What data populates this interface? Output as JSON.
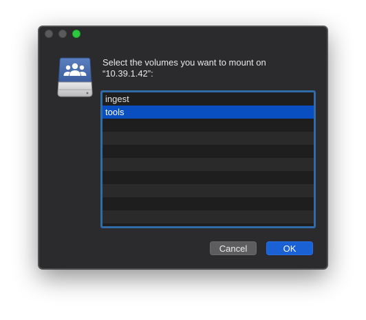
{
  "window": {
    "traffic_lights": {
      "close_color": "#5a5a5c",
      "minimize_color": "#5a5a5c",
      "zoom_color": "#2dc840"
    }
  },
  "dialog": {
    "icon": "network-drive-shared-icon",
    "message_line1": "Select the volumes you want to mount on",
    "message_line2": "“10.39.1.42”:"
  },
  "volumes": {
    "items": [
      {
        "label": "ingest",
        "selected": false
      },
      {
        "label": "tools",
        "selected": true
      },
      {
        "label": "",
        "selected": false
      },
      {
        "label": "",
        "selected": false
      },
      {
        "label": "",
        "selected": false
      },
      {
        "label": "",
        "selected": false
      },
      {
        "label": "",
        "selected": false
      },
      {
        "label": "",
        "selected": false
      },
      {
        "label": "",
        "selected": false
      },
      {
        "label": "",
        "selected": false
      }
    ],
    "selection_color": "#0a4fc2",
    "focus_ring_color": "#2f6ca8"
  },
  "buttons": {
    "cancel_label": "Cancel",
    "ok_label": "OK",
    "accent_color": "#1a61d6"
  }
}
